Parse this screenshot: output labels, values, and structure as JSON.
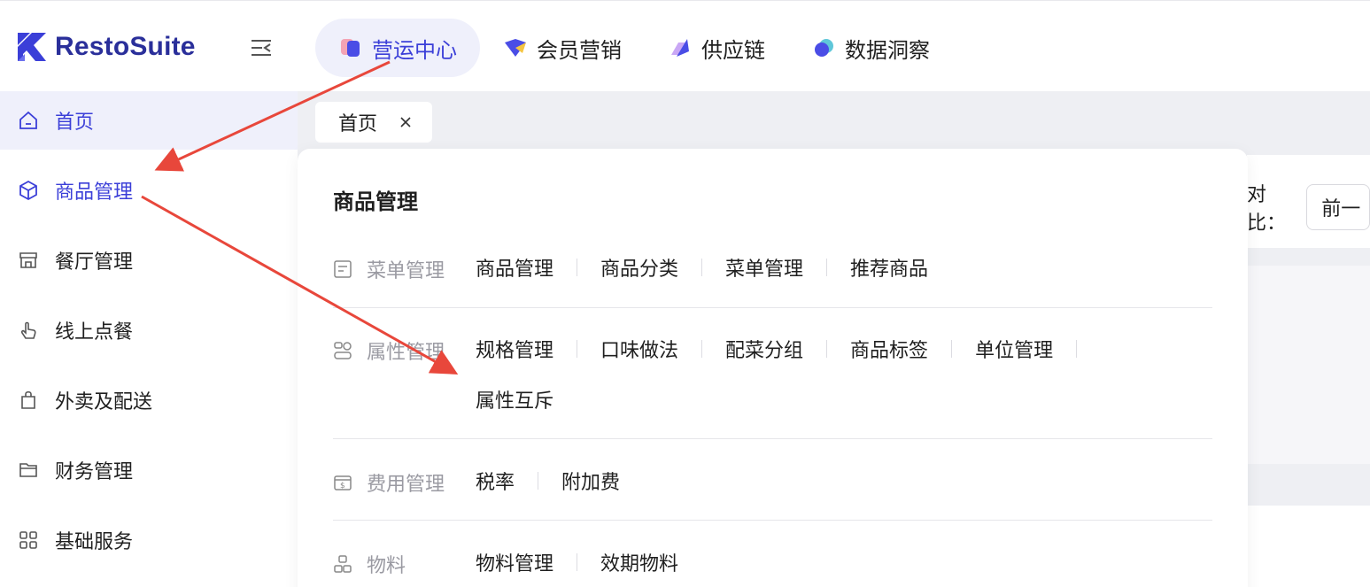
{
  "app": {
    "logo_text": "RestoSuite",
    "brand_color": "#3b3fd8"
  },
  "top_nav": [
    {
      "label": "营运中心",
      "icon": "operations-icon",
      "active": true
    },
    {
      "label": "会员营销",
      "icon": "membership-icon",
      "active": false
    },
    {
      "label": "供应链",
      "icon": "supply-chain-icon",
      "active": false
    },
    {
      "label": "数据洞察",
      "icon": "data-insight-icon",
      "active": false
    }
  ],
  "sidebar": {
    "items": [
      {
        "label": "首页",
        "icon": "home-icon"
      },
      {
        "label": "商品管理",
        "icon": "cube-icon"
      },
      {
        "label": "餐厅管理",
        "icon": "store-icon"
      },
      {
        "label": "线上点餐",
        "icon": "tap-hand-icon"
      },
      {
        "label": "外卖及配送",
        "icon": "shopping-bag-icon"
      },
      {
        "label": "财务管理",
        "icon": "folder-icon"
      },
      {
        "label": "基础服务",
        "icon": "grid-icon"
      }
    ]
  },
  "tabs": [
    {
      "label": "首页"
    }
  ],
  "compare": {
    "label": "对比：",
    "value": "前一"
  },
  "panel": {
    "title": "商品管理",
    "groups": [
      {
        "label": "菜单管理",
        "icon": "menu-doc-icon",
        "links": [
          "商品管理",
          "商品分类",
          "菜单管理",
          "推荐商品"
        ]
      },
      {
        "label": "属性管理",
        "icon": "attribute-icon",
        "links": [
          "规格管理",
          "口味做法",
          "配菜分组",
          "商品标签",
          "单位管理"
        ],
        "links_row2": [
          "属性互斥"
        ]
      },
      {
        "label": "费用管理",
        "icon": "fee-icon",
        "links": [
          "税率",
          "附加费"
        ]
      },
      {
        "label": "物料",
        "icon": "material-icon",
        "links": [
          "物料管理",
          "效期物料"
        ]
      }
    ]
  },
  "annotation": {
    "arrow_color": "#e8473b"
  }
}
